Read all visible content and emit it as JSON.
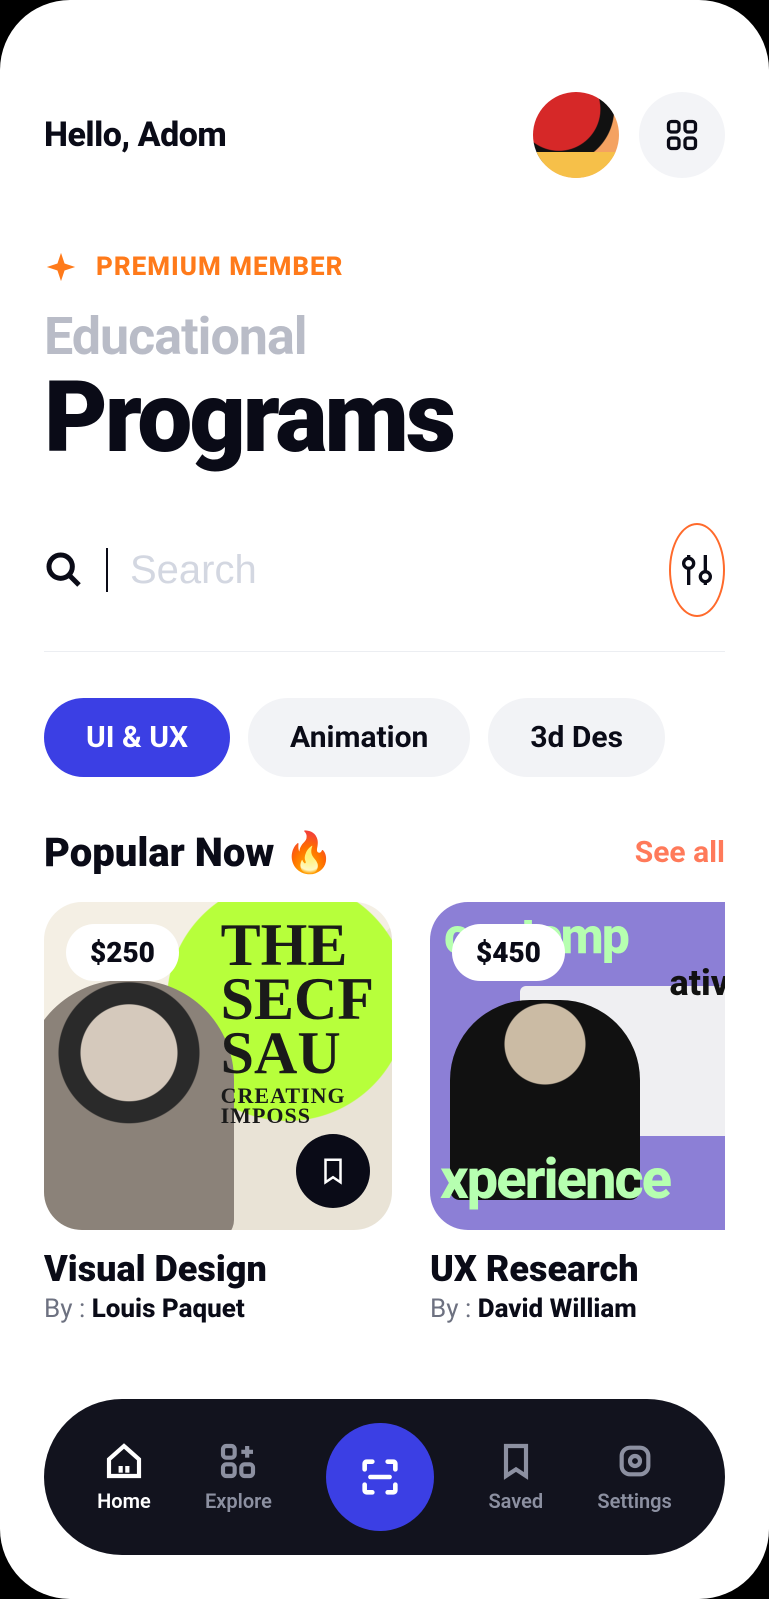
{
  "header": {
    "greeting": "Hello, Adom"
  },
  "premium": {
    "label": "PREMIUM MEMBER"
  },
  "title": {
    "sub": "Educational",
    "main": "Programs"
  },
  "search": {
    "placeholder": "Search"
  },
  "chips": [
    {
      "label": "UI & UX",
      "active": true
    },
    {
      "label": "Animation",
      "active": false
    },
    {
      "label": "3d Des",
      "active": false
    }
  ],
  "popular": {
    "title": "Popular Now",
    "emoji": "🔥",
    "see_all": "See all"
  },
  "cards": [
    {
      "price": "$250",
      "title": "Visual Design",
      "by_prefix": "By : ",
      "author": "Louis Paquet"
    },
    {
      "price": "$450",
      "title": "UX Research",
      "by_prefix": "By : ",
      "author": "David William"
    }
  ],
  "nav": {
    "home": "Home",
    "explore": "Explore",
    "saved": "Saved",
    "settings": "Settings"
  }
}
